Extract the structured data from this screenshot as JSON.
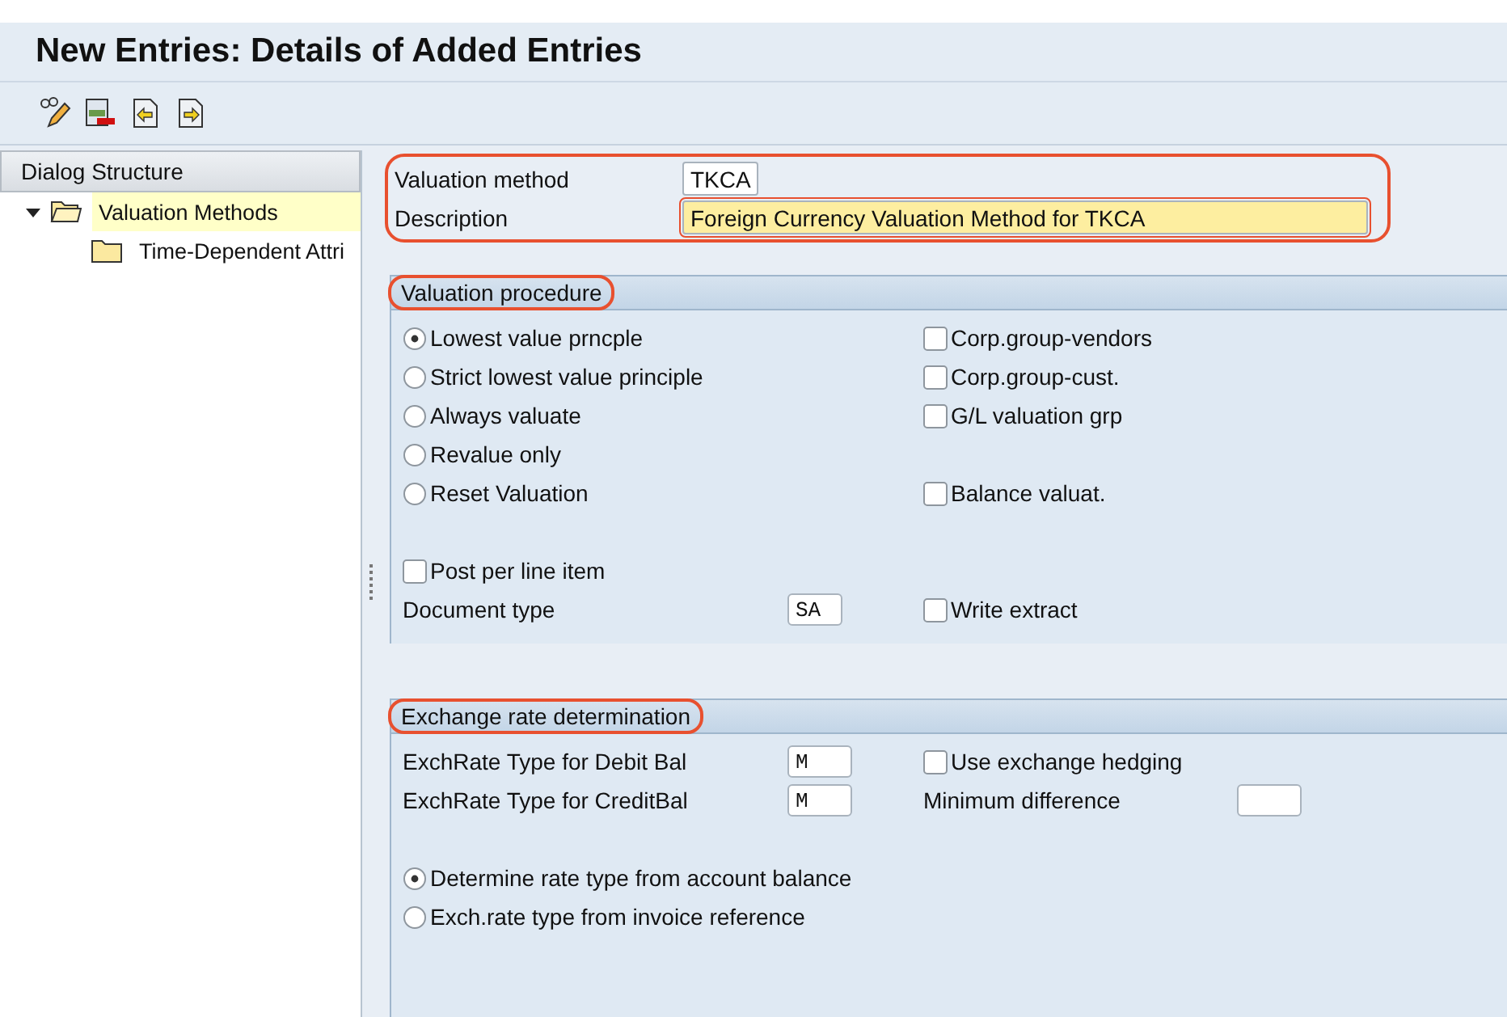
{
  "title": "New Entries: Details of Added Entries",
  "dialog_structure": {
    "title": "Dialog Structure",
    "items": [
      {
        "label": "Valuation Methods",
        "expanded": true,
        "selected": true,
        "children": [
          {
            "label": "Time-Dependent Attri",
            "selected": false
          }
        ]
      }
    ]
  },
  "header_fields": [
    {
      "label": "Valuation method",
      "value": "TKCA",
      "focused": false
    },
    {
      "label": "Description",
      "value": "Foreign Currency Valuation Method for TKCA",
      "focused": true
    }
  ],
  "panels": [
    {
      "title": "Valuation procedure",
      "groups": [
        [
          {
            "left": {
              "kind": "radio",
              "label": "Lowest value prncple",
              "selected": true
            },
            "right": {
              "kind": "checkbox",
              "label": "Corp.group-vendors",
              "checked": false
            }
          },
          {
            "left": {
              "kind": "radio",
              "label": "Strict lowest value principle",
              "selected": false
            },
            "right": {
              "kind": "checkbox",
              "label": "Corp.group-cust.",
              "checked": false
            }
          },
          {
            "left": {
              "kind": "radio",
              "label": "Always valuate",
              "selected": false
            },
            "right": {
              "kind": "checkbox",
              "label": "G/L valuation grp",
              "checked": false
            }
          },
          {
            "left": {
              "kind": "radio",
              "label": "Revalue only",
              "selected": false
            }
          },
          {
            "left": {
              "kind": "radio",
              "label": "Reset Valuation",
              "selected": false
            },
            "right": {
              "kind": "checkbox",
              "label": "Balance valuat.",
              "checked": false
            }
          }
        ],
        [
          {
            "left": {
              "kind": "checkbox",
              "label": "Post per line item",
              "checked": false
            }
          },
          {
            "left": {
              "kind": "field",
              "label": "Document type",
              "value": "SA"
            },
            "right": {
              "kind": "checkbox",
              "label": "Write extract",
              "checked": false
            }
          }
        ]
      ]
    },
    {
      "title": "Exchange rate determination",
      "groups": [
        [
          {
            "left": {
              "kind": "field",
              "label": "ExchRate Type for Debit Bal",
              "value": "M"
            },
            "right": {
              "kind": "checkbox",
              "label": "Use exchange hedging",
              "checked": false
            }
          },
          {
            "left": {
              "kind": "field",
              "label": "ExchRate Type for CreditBal",
              "value": "M"
            },
            "right": {
              "kind": "field",
              "label": "Minimum difference"
            }
          }
        ],
        [
          {
            "left": {
              "kind": "radio",
              "label": "Determine rate type from account balance",
              "selected": true
            }
          },
          {
            "left": {
              "kind": "radio",
              "label": "Exch.rate type from invoice reference",
              "selected": false
            }
          }
        ]
      ]
    }
  ]
}
